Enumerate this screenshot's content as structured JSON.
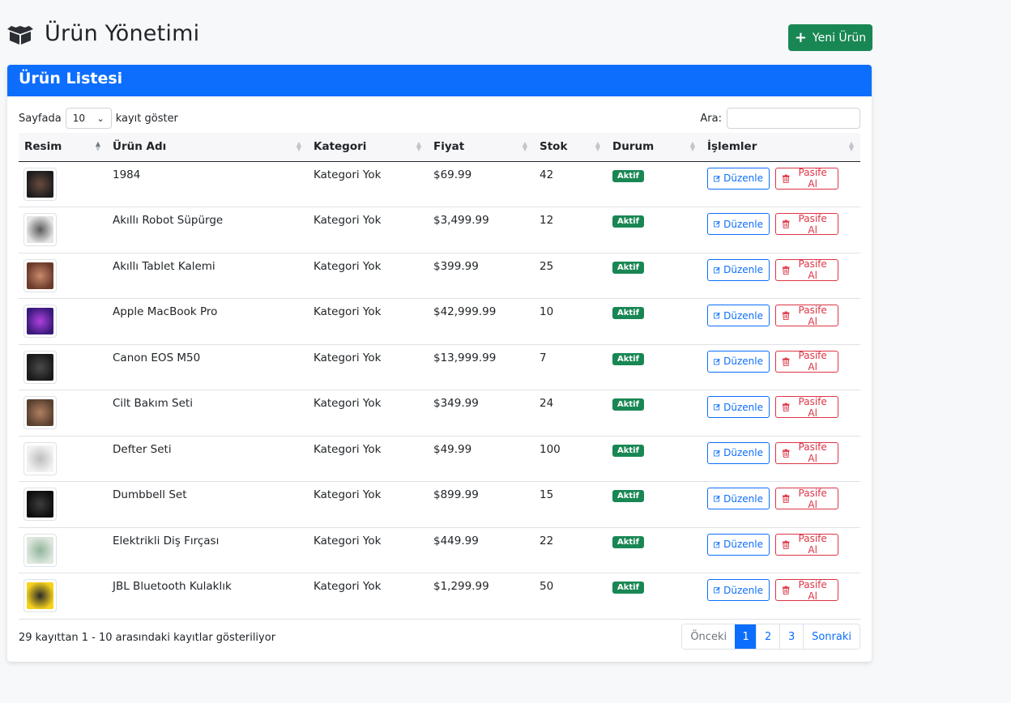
{
  "page": {
    "title": "Ürün Yönetimi",
    "new_button": "Yeni Ürün"
  },
  "card": {
    "title": "Ürün Listesi",
    "length_prefix": "Sayfada",
    "length_value": "10",
    "length_suffix": "kayıt göster",
    "search_label": "Ara:",
    "search_value": ""
  },
  "table": {
    "columns": [
      "Resim",
      "Ürün Adı",
      "Kategori",
      "Fiyat",
      "Stok",
      "Durum",
      "İşlemler"
    ],
    "edit_label": "Düzenle",
    "deactivate_label": "Pasife Al",
    "rows": [
      {
        "name": "1984",
        "category": "Kategori Yok",
        "price": "$69.99",
        "stock": "42",
        "status": "Aktif",
        "thumb": [
          "#1d1d1f",
          "#6a4b3c"
        ]
      },
      {
        "name": "Akıllı Robot Süpürge",
        "category": "Kategori Yok",
        "price": "$3,499.99",
        "stock": "12",
        "status": "Aktif",
        "thumb": [
          "#e6e6e6",
          "#5a5a5a"
        ]
      },
      {
        "name": "Akıllı Tablet Kalemi",
        "category": "Kategori Yok",
        "price": "$399.99",
        "stock": "25",
        "status": "Aktif",
        "thumb": [
          "#6b3a2c",
          "#c98a6a"
        ]
      },
      {
        "name": "Apple MacBook Pro",
        "category": "Kategori Yok",
        "price": "$42,999.99",
        "stock": "10",
        "status": "Aktif",
        "thumb": [
          "#3a1a7a",
          "#b040e0"
        ]
      },
      {
        "name": "Canon EOS M50",
        "category": "Kategori Yok",
        "price": "$13,999.99",
        "stock": "7",
        "status": "Aktif",
        "thumb": [
          "#1a1a1a",
          "#4a4a4a"
        ]
      },
      {
        "name": "Cilt Bakım Seti",
        "category": "Kategori Yok",
        "price": "$349.99",
        "stock": "24",
        "status": "Aktif",
        "thumb": [
          "#5a4030",
          "#b08060"
        ]
      },
      {
        "name": "Defter Seti",
        "category": "Kategori Yok",
        "price": "$49.99",
        "stock": "100",
        "status": "Aktif",
        "thumb": [
          "#f2f2f2",
          "#bdbdbd"
        ]
      },
      {
        "name": "Dumbbell Set",
        "category": "Kategori Yok",
        "price": "$899.99",
        "stock": "15",
        "status": "Aktif",
        "thumb": [
          "#0e0e0e",
          "#3c3c3c"
        ]
      },
      {
        "name": "Elektrikli Diş Fırçası",
        "category": "Kategori Yok",
        "price": "$449.99",
        "stock": "22",
        "status": "Aktif",
        "thumb": [
          "#dfe8df",
          "#8fb59a"
        ]
      },
      {
        "name": "JBL Bluetooth Kulaklık",
        "category": "Kategori Yok",
        "price": "$1,299.99",
        "stock": "50",
        "status": "Aktif",
        "thumb": [
          "#f6d21c",
          "#2a2a2a"
        ]
      }
    ]
  },
  "footer": {
    "info": "29 kayıttan 1 - 10 arasındaki kayıtlar gösteriliyor",
    "prev": "Önceki",
    "pages": [
      "1",
      "2",
      "3"
    ],
    "next": "Sonraki"
  },
  "colors": {
    "primary": "#0d6efd",
    "success": "#198754",
    "danger": "#dc3545"
  }
}
